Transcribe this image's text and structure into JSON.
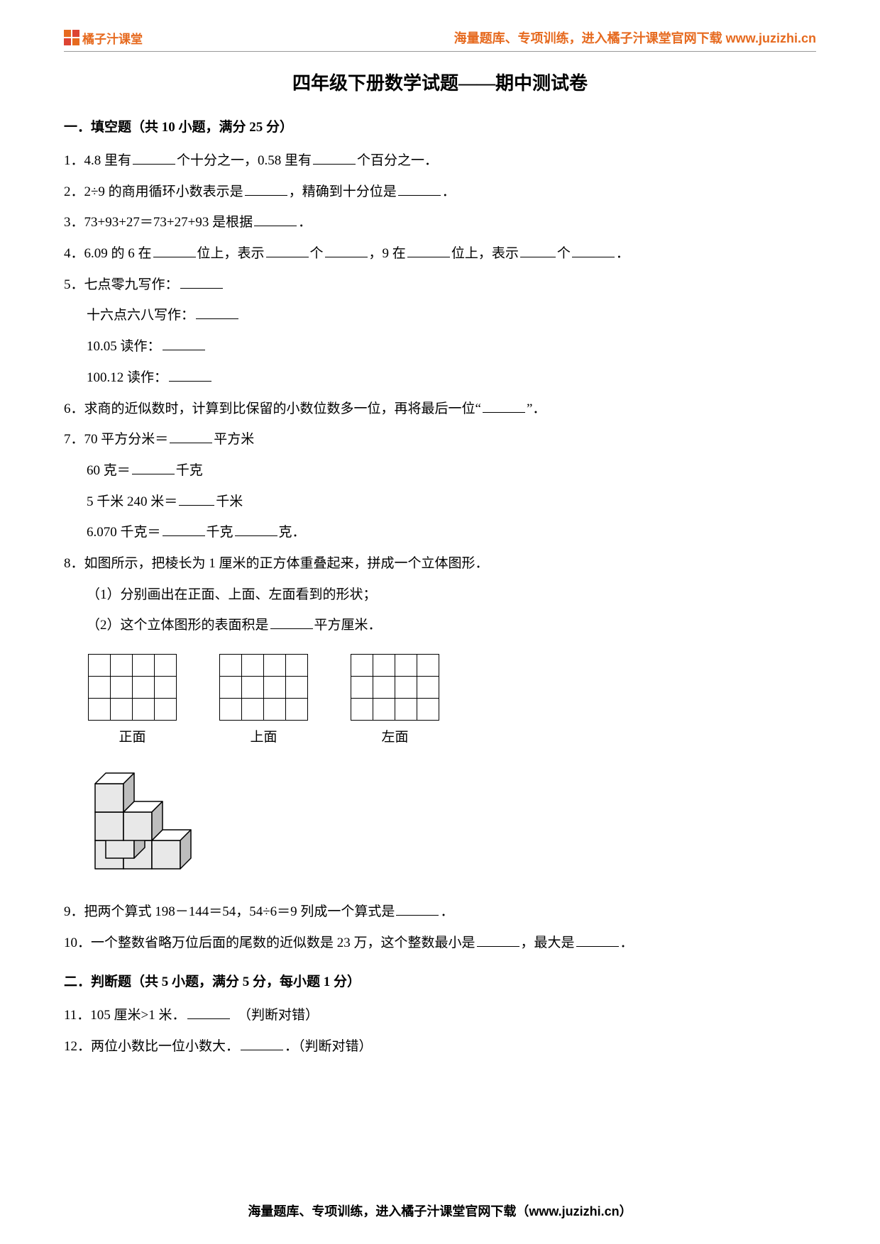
{
  "header": {
    "logo_text": "橘子汁课堂",
    "right_text": "海量题库、专项训练，进入橘子汁课堂官网下载 www.juzizhi.cn"
  },
  "title": "四年级下册数学试题——期中测试卷",
  "sections": {
    "s1": "一．填空题（共 10 小题，满分 25 分）",
    "s2": "二．判断题（共 5 小题，满分 5 分，每小题 1 分）"
  },
  "questions": {
    "q1_a": "1．4.8 里有",
    "q1_b": "个十分之一，0.58 里有",
    "q1_c": "个百分之一．",
    "q2_a": "2．2÷9 的商用循环小数表示是",
    "q2_b": "，精确到十分位是",
    "q2_c": "．",
    "q3_a": "3．73+93+27＝73+27+93 是根据",
    "q3_b": "．",
    "q4_a": "4．6.09 的 6 在",
    "q4_b": "位上，表示",
    "q4_c": "个",
    "q4_d": "，9 在",
    "q4_e": "位上，表示",
    "q4_f": "个",
    "q4_g": "．",
    "q5_1": "5．七点零九写作：",
    "q5_2": "十六点六八写作：",
    "q5_3": "10.05 读作：",
    "q5_4": "100.12 读作：",
    "q6_a": "6．求商的近似数时，计算到比保留的小数位数多一位，再将最后一位“",
    "q6_b": "”．",
    "q7_1a": "7．70 平方分米＝",
    "q7_1b": "平方米",
    "q7_2a": "60 克＝",
    "q7_2b": "千克",
    "q7_3a": "5 千米 240 米＝",
    "q7_3b": "千米",
    "q7_4a": "6.070 千克＝",
    "q7_4b": "千克",
    "q7_4c": "克．",
    "q8_1": "8．如图所示，把棱长为 1 厘米的正方体重叠起来，拼成一个立体图形．",
    "q8_2": "（1）分别画出在正面、上面、左面看到的形状；",
    "q8_3a": "（2）这个立体图形的表面积是",
    "q8_3b": "平方厘米．",
    "label_front": "正面",
    "label_top": "上面",
    "label_left": "左面",
    "q9_a": "9．把两个算式 198－144＝54，54÷6＝9 列成一个算式是",
    "q9_b": "．",
    "q10_a": "10．一个整数省略万位后面的尾数的近似数是 23 万，这个整数最小是",
    "q10_b": "，最大是",
    "q10_c": "．",
    "q11_a": "11．105 厘米>1 米．",
    "q11_b": "（判断对错）",
    "q12_a": "12．两位小数比一位小数大．",
    "q12_b": "．（判断对错）"
  },
  "footer": "海量题库、专项训练，进入橘子汁课堂官网下载（www.juzizhi.cn）"
}
